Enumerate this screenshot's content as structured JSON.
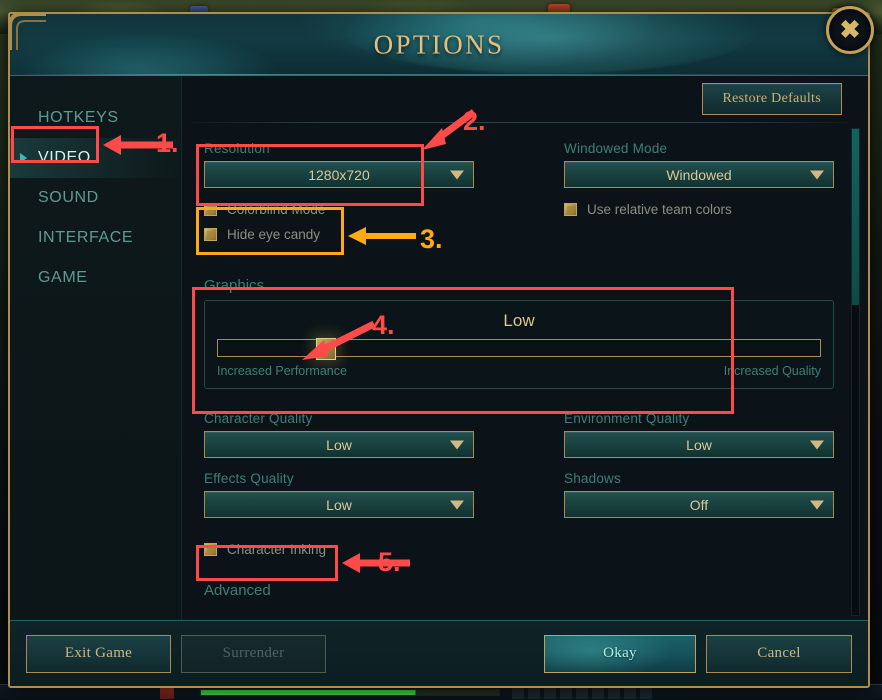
{
  "window": {
    "title": "OPTIONS",
    "close_icon": "close-x-icon"
  },
  "sidebar": {
    "items": [
      {
        "label": "HOTKEYS",
        "active": false
      },
      {
        "label": "VIDEO",
        "active": true
      },
      {
        "label": "SOUND",
        "active": false
      },
      {
        "label": "INTERFACE",
        "active": false
      },
      {
        "label": "GAME",
        "active": false
      }
    ]
  },
  "toolbar": {
    "restore_defaults_label": "Restore Defaults"
  },
  "video": {
    "resolution": {
      "label": "Resolution",
      "value": "1280x720",
      "caret_icon": "chevron-down-icon"
    },
    "windowed_mode": {
      "label": "Windowed Mode",
      "value": "Windowed",
      "caret_icon": "chevron-down-icon"
    },
    "checkboxes_left": [
      {
        "label": "Colorblind Mode",
        "checked": true
      },
      {
        "label": "Hide eye candy",
        "checked": true
      }
    ],
    "checkboxes_right": [
      {
        "label": "Use relative team colors",
        "checked": true
      }
    ],
    "graphics": {
      "heading": "Graphics",
      "value": "Low",
      "slider_percent": 18,
      "left_end_label": "Increased Performance",
      "right_end_label": "Increased Quality"
    },
    "quality": [
      {
        "label": "Character Quality",
        "value": "Low",
        "caret_icon": "chevron-down-icon"
      },
      {
        "label": "Environment Quality",
        "value": "Low",
        "caret_icon": "chevron-down-icon"
      },
      {
        "label": "Effects Quality",
        "value": "Low",
        "caret_icon": "chevron-down-icon"
      },
      {
        "label": "Shadows",
        "value": "Off",
        "caret_icon": "chevron-down-icon"
      }
    ],
    "character_inking": {
      "label": "Character Inking",
      "checked": true
    },
    "advanced_heading": "Advanced"
  },
  "footer": {
    "exit_game": "Exit Game",
    "surrender": "Surrender",
    "okay": "Okay",
    "cancel": "Cancel"
  },
  "annotations": {
    "colors": {
      "red": "#ff4a4a",
      "orange": "#ffaa14"
    },
    "markers": [
      {
        "id": "1",
        "text": "1.",
        "color": "red",
        "target": "sidebar-item-video"
      },
      {
        "id": "2",
        "text": "2.",
        "color": "red",
        "target": "resolution-dropdown"
      },
      {
        "id": "3",
        "text": "3.",
        "color": "orange",
        "target": "colorblind-and-eyecandy-checkboxes"
      },
      {
        "id": "4",
        "text": "4.",
        "color": "red",
        "target": "graphics-slider-thumb"
      },
      {
        "id": "5",
        "text": "5.",
        "color": "red",
        "target": "character-inking-checkbox"
      }
    ]
  }
}
